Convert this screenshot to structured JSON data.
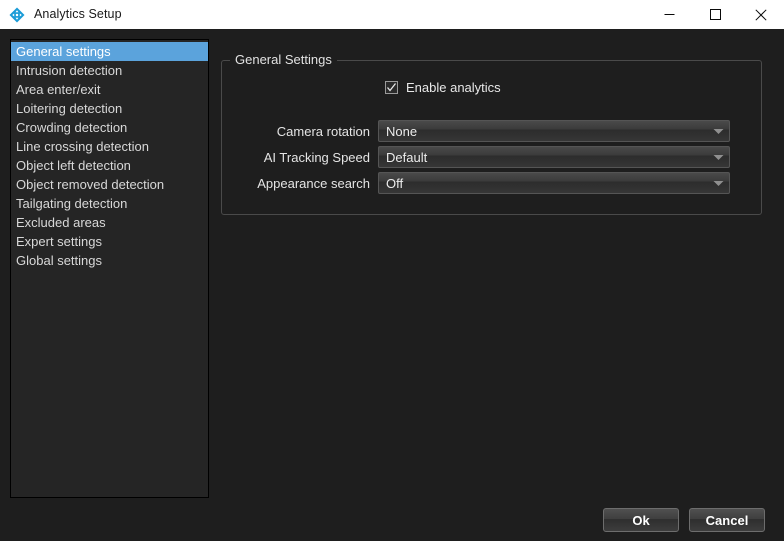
{
  "window": {
    "title": "Analytics Setup",
    "app_icon": "move-compass-icon",
    "controls": {
      "minimize": "minimize-icon",
      "maximize": "maximize-icon",
      "close": "close-icon"
    }
  },
  "sidebar": {
    "selected_index": 0,
    "items": [
      {
        "label": "General settings"
      },
      {
        "label": "Intrusion detection"
      },
      {
        "label": "Area enter/exit"
      },
      {
        "label": "Loitering detection"
      },
      {
        "label": "Crowding detection"
      },
      {
        "label": "Line crossing detection"
      },
      {
        "label": "Object left detection"
      },
      {
        "label": "Object removed detection"
      },
      {
        "label": "Tailgating detection"
      },
      {
        "label": "Excluded areas"
      },
      {
        "label": "Expert settings"
      },
      {
        "label": "Global settings"
      }
    ]
  },
  "main": {
    "group_title": "General Settings",
    "checkbox": {
      "label": "Enable analytics",
      "checked": true
    },
    "fields": [
      {
        "label": "Camera rotation",
        "value": "None"
      },
      {
        "label": "AI Tracking Speed",
        "value": "Default"
      },
      {
        "label": "Appearance search",
        "value": "Off"
      }
    ]
  },
  "footer": {
    "ok_label": "Ok",
    "cancel_label": "Cancel"
  },
  "colors": {
    "background": "#1e1e1e",
    "titlebar": "#ffffff",
    "selection": "#5ba3dc",
    "accent": "#1a9bd7",
    "text": "#e4e4e4"
  }
}
